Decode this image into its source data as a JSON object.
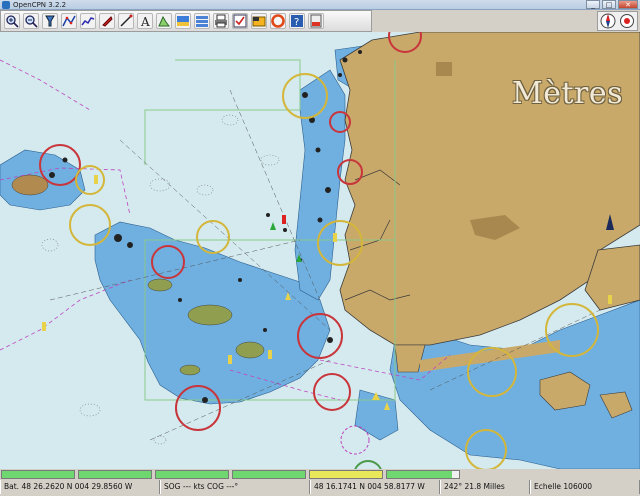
{
  "window": {
    "title": "OpenCPN 3.2.2",
    "minimize": "_",
    "maximize": "□",
    "close": "✕"
  },
  "toolbar": {
    "tools": [
      {
        "icon": "zoom-in-icon"
      },
      {
        "icon": "zoom-out-icon"
      },
      {
        "icon": "chart-quilt-icon"
      },
      {
        "icon": "route-icon"
      },
      {
        "icon": "track-icon"
      },
      {
        "icon": "ship-follow-icon"
      },
      {
        "icon": "measure-icon"
      },
      {
        "icon": "text-icon"
      },
      {
        "icon": "tides-icon"
      },
      {
        "icon": "currents-icon"
      },
      {
        "icon": "chart-toolbox-icon"
      },
      {
        "icon": "print-icon"
      },
      {
        "icon": "route-manager-icon"
      },
      {
        "icon": "color-scheme-icon"
      },
      {
        "icon": "mob-icon"
      },
      {
        "icon": "help-icon"
      },
      {
        "icon": "settings-icon"
      }
    ]
  },
  "compass": {
    "icons": [
      "compass-icon",
      "gps-status-icon"
    ]
  },
  "chart": {
    "units_label": "Mètres",
    "colors": {
      "deep": "#d4eaee",
      "shallow": "#6fb0e0",
      "land": "#c9a96a",
      "dry": "#8f9f4f"
    }
  },
  "status": {
    "progress_bars": [
      {
        "color": "#6fd76f",
        "fill": 1.0
      },
      {
        "color": "#6fd76f",
        "fill": 1.0
      },
      {
        "color": "#6fd76f",
        "fill": 1.0
      },
      {
        "color": "#6fd76f",
        "fill": 1.0
      },
      {
        "color": "#e8e85a",
        "fill": 1.0
      },
      {
        "color": "#6fd76f",
        "fill": 0.9
      }
    ],
    "position": "Bat. 48 26.2620 N    004 29.8560 W",
    "sog_cog": "SOG --- kts  COG ---°",
    "cursor": "48 16.1741 N   004 58.8177 W",
    "bearing": "242° 21.8 Milles",
    "scale": "Echelle 106000"
  }
}
